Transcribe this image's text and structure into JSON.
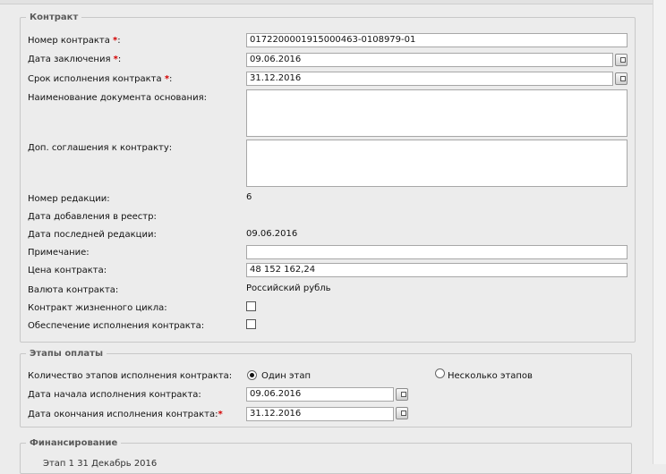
{
  "contract": {
    "legend": "Контракт",
    "number": {
      "label": "Номер контракта",
      "value": "0172200001915000463-0108979-01"
    },
    "conclusion_date": {
      "label": "Дата заключения",
      "value": "09.06.2016"
    },
    "term": {
      "label": "Срок исполнения контракта",
      "value": "31.12.2016"
    },
    "basis_doc": {
      "label": "Наименование документа основания:"
    },
    "add_agreements": {
      "label": "Доп. соглашения к контракту:"
    },
    "revision_number": {
      "label": "Номер редакции:",
      "value": "6"
    },
    "registry_date": {
      "label": "Дата добавления в реестр:"
    },
    "last_revision_date": {
      "label": "Дата последней редакции:",
      "value": "09.06.2016"
    },
    "note": {
      "label": "Примечание:",
      "value": ""
    },
    "price": {
      "label": "Цена контракта:",
      "value": "48 152 162,24"
    },
    "currency": {
      "label": "Валюта контракта:",
      "value": "Российский рубль"
    },
    "lifecycle": {
      "label": "Контракт жизненного цикла:"
    },
    "security": {
      "label": "Обеспечение исполнения контракта:"
    },
    "required_mark": "*",
    "colon": ":"
  },
  "payment": {
    "legend": "Этапы оплаты",
    "stages_count": {
      "label": "Количество этапов исполнения контракта:",
      "option_one": "Один этап",
      "option_many": "Несколько этапов"
    },
    "start_date": {
      "label": "Дата начала исполнения контракта:",
      "value": "09.06.2016"
    },
    "end_date": {
      "label": "Дата окончания исполнения контракта:",
      "value": "31.12.2016"
    }
  },
  "financing": {
    "legend": "Финансирование",
    "stage_partial": "Этап 1 31 Декабрь 2016"
  }
}
